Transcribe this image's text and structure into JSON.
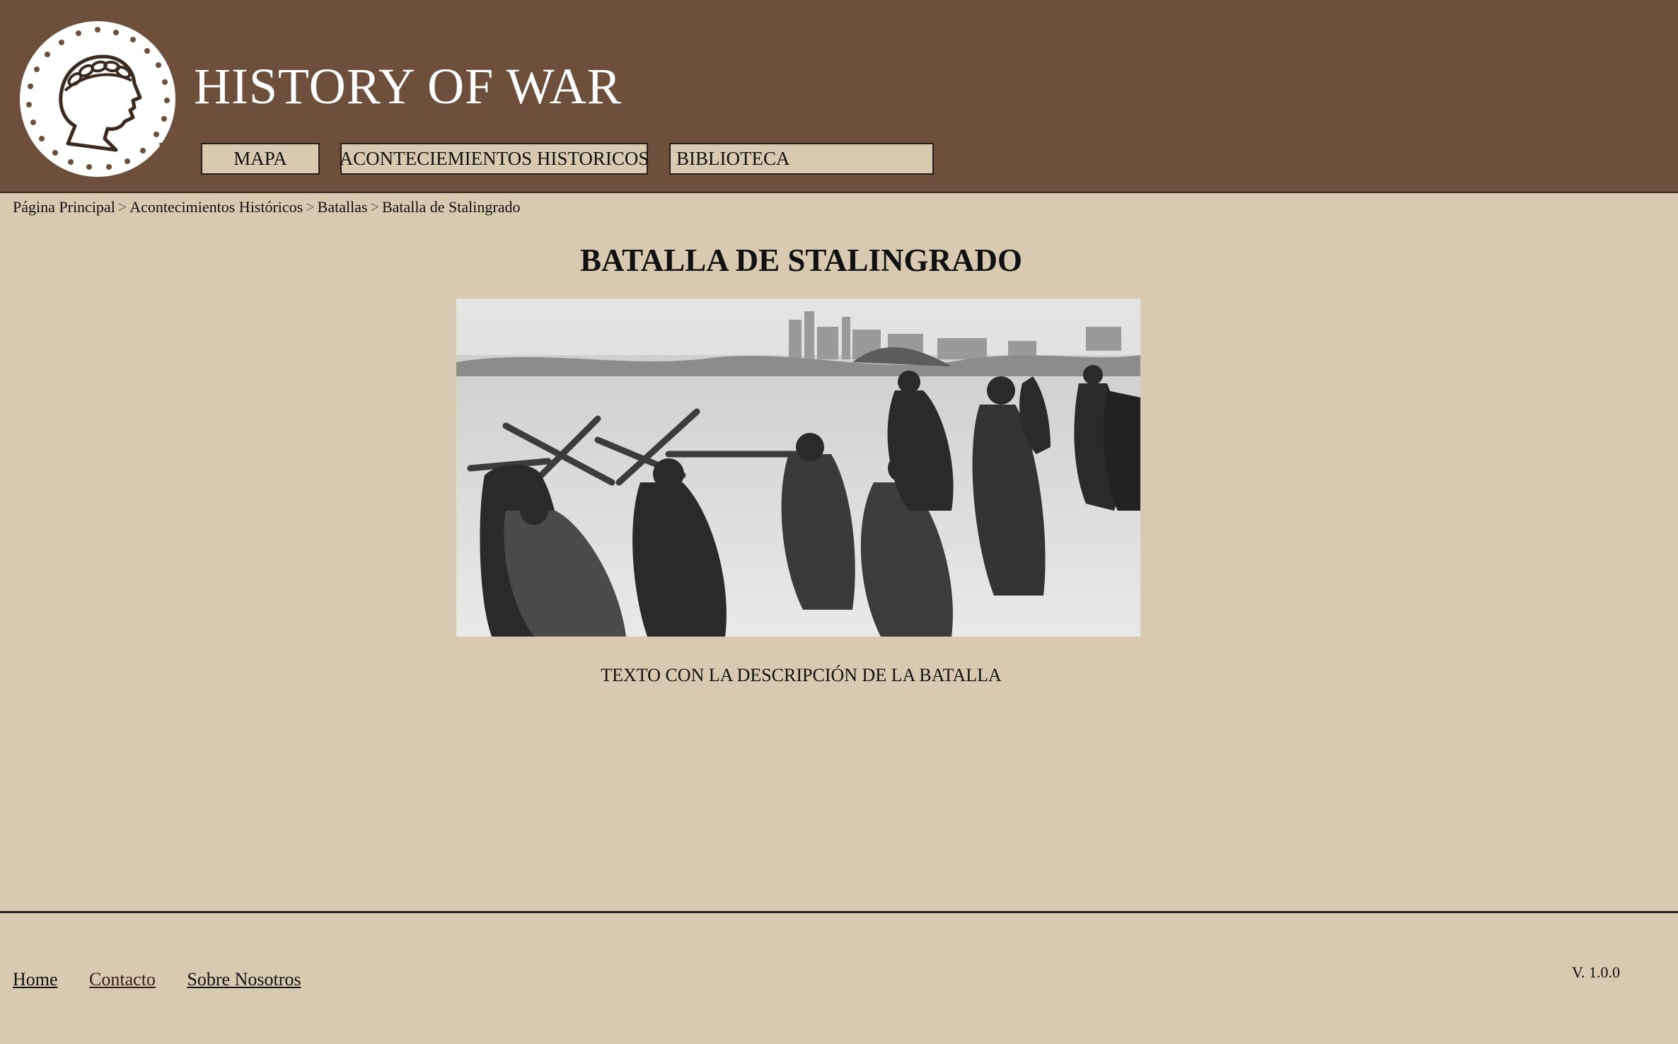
{
  "header": {
    "logo_icon": "laurel-head-coin-icon",
    "title": "HISTORY OF WAR",
    "background_color": "#6e4f3b",
    "nav": [
      {
        "label": "MAPA"
      },
      {
        "label": "ACONTECIEMIENTOS HISTORICOS"
      },
      {
        "label": "BIBLIOTECA"
      }
    ]
  },
  "breadcrumb": {
    "items": [
      "Página Principal",
      "Acontecimientos Históricos",
      "Batallas",
      "Batalla de Stalingrado"
    ],
    "separator": ">"
  },
  "main": {
    "title": "BATALLA DE STALINGRADO",
    "image_subject": "black-and-white-photo-of-soldiers-walking-through-snowy-ruined-city",
    "description": "TEXTO CON LA DESCRIPCIÓN DE LA BATALLA"
  },
  "footer": {
    "links": [
      {
        "label": "Home"
      },
      {
        "label": "Contacto"
      },
      {
        "label": "Sobre Nosotros"
      }
    ],
    "version": "V. 1.0.0"
  },
  "colors": {
    "page_background": "#d7cab0",
    "header_background": "#6e4f3b",
    "title_text": "#ffffff"
  }
}
